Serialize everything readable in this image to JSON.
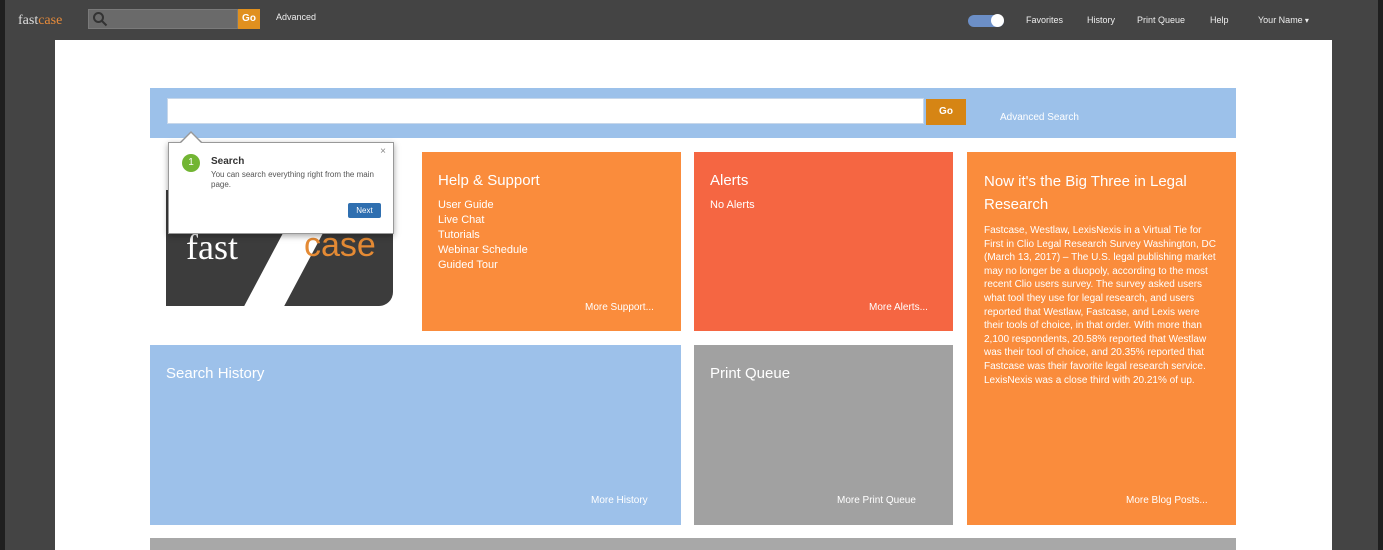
{
  "topbar": {
    "logo_fast": "fast",
    "logo_case": "case",
    "search_button": "Go",
    "advanced_link": "Advanced",
    "nav": [
      "Favorites",
      "History",
      "Print Queue",
      "Help"
    ],
    "user_menu": "Your Name"
  },
  "search": {
    "go_label": "Go",
    "advanced_link": "Advanced Search"
  },
  "tooltip": {
    "step": "1",
    "title": "Search",
    "body": "You can search everything right from the main page.",
    "close": "×",
    "next": "Next"
  },
  "logo_tile": {
    "fast": "fast",
    "case": "case"
  },
  "help": {
    "title": "Help & Support",
    "links": [
      "User Guide",
      "Live Chat",
      "Tutorials",
      "Webinar Schedule",
      "Guided Tour"
    ],
    "more": "More Support..."
  },
  "alerts": {
    "title": "Alerts",
    "status": "No Alerts",
    "more": "More Alerts..."
  },
  "news": {
    "title": "Now it's the Big Three in Legal Research",
    "body": "Fastcase, Westlaw, LexisNexis in a Virtual Tie for First in Clio Legal Research Survey Washington, DC (March 13, 2017) – The U.S. legal publishing market may no longer be a duopoly, according to the most recent Clio users survey. The survey asked users what tool they use for legal research, and users reported that Westlaw, Fastcase, and Lexis were their tools of choice, in that order. With more than 2,100 respondents, 20.58% reported that Westlaw was their tool of choice, and 20.35% reported that Fastcase was their favorite legal research service. LexisNexis was a close third with 20.21% of up.",
    "more": "More Blog Posts..."
  },
  "history": {
    "title": "Search History",
    "more": "More History"
  },
  "print_queue": {
    "title": "Print Queue",
    "more": "More Print Queue"
  },
  "colors": {
    "orange": "#fa8c3c",
    "red": "#f56642",
    "blue": "#9dc1ea",
    "gray": "#a1a1a1",
    "topbar": "#444444"
  }
}
